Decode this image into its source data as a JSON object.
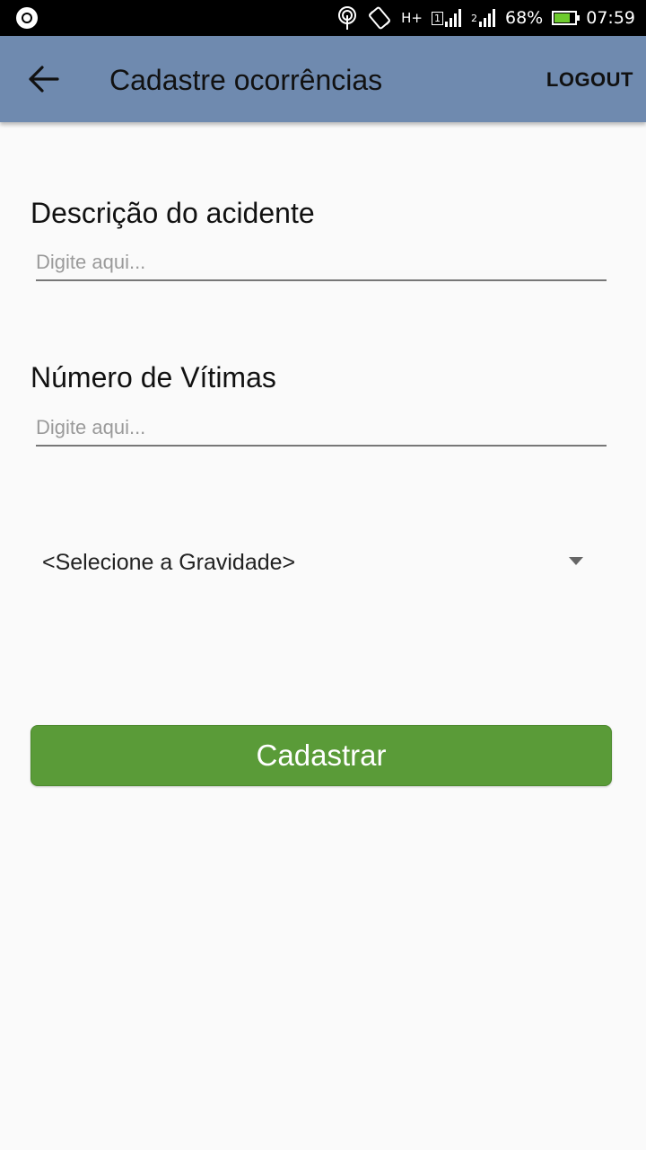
{
  "status_bar": {
    "battery": "68%",
    "time": "07:59",
    "network": "H+",
    "sim1": "1",
    "sim2": "2"
  },
  "app_bar": {
    "title": "Cadastre ocorrências",
    "logout_label": "LOGOUT",
    "background_color": "#6f8aaf"
  },
  "form": {
    "description": {
      "label": "Descrição do acidente",
      "placeholder": "Digite aqui...",
      "value": ""
    },
    "victims": {
      "label": "Número de Vítimas",
      "placeholder": "Digite aqui...",
      "value": ""
    },
    "severity": {
      "selected": "<Selecione a Gravidade>"
    },
    "submit_label": "Cadastrar",
    "submit_color": "#5a9b38"
  }
}
